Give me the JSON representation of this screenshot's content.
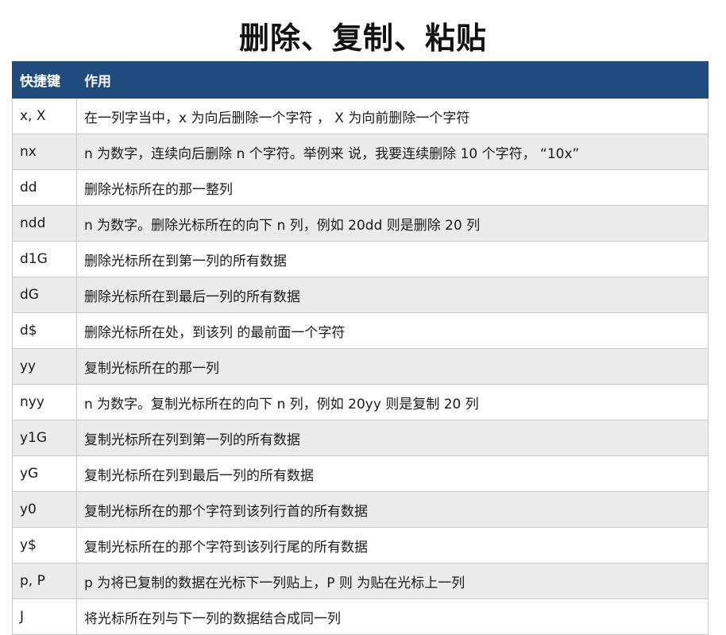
{
  "page": {
    "title": "删除、复制、粘贴"
  },
  "table": {
    "headers": {
      "key": "快捷键",
      "desc": "作用"
    },
    "rows": [
      {
        "key": "x, X",
        "desc": "在一列字当中，x 为向后删除一个字符 ， X 为向前删除一个字符"
      },
      {
        "key": "nx",
        "desc": "n 为数字，连续向后删除 n 个字符。举例来 说，我要连续删除 10 个字符， “10x”"
      },
      {
        "key": "dd",
        "desc": "删除光标所在的那一整列"
      },
      {
        "key": "ndd",
        "desc": "n 为数字。删除光标所在的向下 n 列，例如 20dd 则是删除 20 列"
      },
      {
        "key": "d1G",
        "desc": "删除光标所在到第一列的所有数据"
      },
      {
        "key": "dG",
        "desc": "删除光标所在到最后一列的所有数据"
      },
      {
        "key": "d$",
        "desc": "删除光标所在处，到该列 的最前面一个字符"
      },
      {
        "key": "yy",
        "desc": "复制光标所在的那一列"
      },
      {
        "key": "nyy",
        "desc": "n 为数字。复制光标所在的向下 n 列，例如 20yy 则是复制 20 列"
      },
      {
        "key": "y1G",
        "desc": "复制光标所在列到第一列的所有数据"
      },
      {
        "key": "yG",
        "desc": "复制光标所在列到最后一列的所有数据"
      },
      {
        "key": "y0",
        "desc": "复制光标所在的那个字符到该列行首的所有数据"
      },
      {
        "key": "y$",
        "desc": "复制光标所在的那个字符到该列行尾的所有数据"
      },
      {
        "key": "p, P",
        "desc": "p 为将已复制的数据在光标下一列贴上，P 则 为贴在光标上一列"
      },
      {
        "key": "J",
        "desc": "将光标所在列与下一列的数据结合成同一列"
      }
    ]
  },
  "colors": {
    "header_bg": "#1f4b7f",
    "header_text": "#ffffff",
    "stripe_bg": "#ebebeb",
    "row_bg": "#ffffff",
    "border": "#c8c8c8"
  }
}
